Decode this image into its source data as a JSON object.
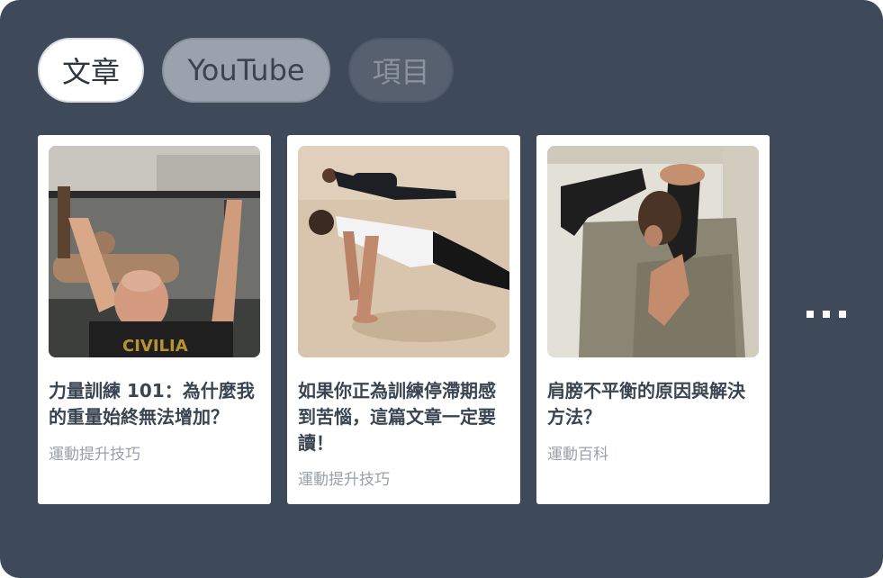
{
  "tabs": [
    {
      "label": "文章",
      "state": "active"
    },
    {
      "label": "YouTube",
      "state": "inactive"
    },
    {
      "label": "項目",
      "state": "disabled"
    }
  ],
  "cards": [
    {
      "title": "力量訓練 101：為什麼我的重量始終無法增加？",
      "category": "運動提升技巧",
      "image": "man-doing-pull-ups-photo"
    },
    {
      "title": "如果你正為訓練停滯期感到苦惱，這篇文章一定要讀！",
      "category": "運動提升技巧",
      "image": "people-doing-push-ups-on-sand-photo"
    },
    {
      "title": "肩膀不平衡的原因與解決方法？",
      "category": "運動百科",
      "image": "man-stretching-shoulder-photo"
    }
  ],
  "more_icon": "ellipsis-icon",
  "colors": {
    "background": "#3e4a59",
    "card": "#ffffff",
    "title": "#3a4452",
    "category": "#9aa1aa"
  }
}
